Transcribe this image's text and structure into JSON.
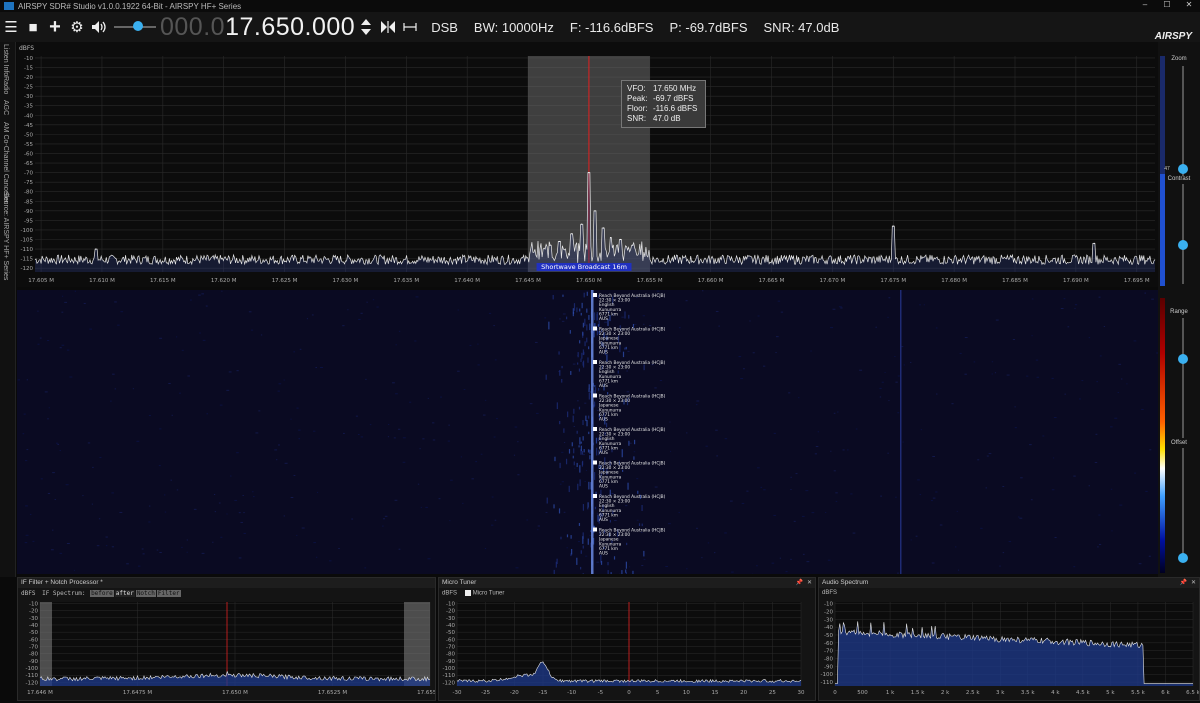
{
  "window": {
    "title": "AIRSPY SDR# Studio v1.0.0.1922 64-Bit - AIRSPY HF+ Series",
    "controls": [
      "–",
      "☐",
      "✕"
    ]
  },
  "toolbar": {
    "freq_dim": "000.0",
    "freq_lit": "17.650.000",
    "mode": "DSB",
    "bw": "BW: 10000Hz",
    "floor": "F: -116.6dBFS",
    "peak": "P: -69.7dBFS",
    "snr": "SNR: 47.0dB",
    "brand": "AIRSPY",
    "volume_level": 0.55
  },
  "left_tabs": [
    "Listen Info",
    "Radio",
    "AGC",
    "AM Co-Channel Canceller",
    "Source: AIRSPY HF+ Series"
  ],
  "spectrum": {
    "unit": "dBFS",
    "y_ticks": [
      -10,
      -15,
      -20,
      -25,
      -30,
      -35,
      -40,
      -45,
      -50,
      -55,
      -60,
      -65,
      -70,
      -75,
      -80,
      -85,
      -90,
      -95,
      -100,
      -105,
      -110,
      -115,
      -120
    ],
    "x_ticks": [
      "17.605 M",
      "17.610 M",
      "17.615 M",
      "17.620 M",
      "17.625 M",
      "17.630 M",
      "17.635 M",
      "17.640 M",
      "17.645 M",
      "17.650 M",
      "17.655 M",
      "17.660 M",
      "17.665 M",
      "17.670 M",
      "17.675 M",
      "17.680 M",
      "17.685 M",
      "17.690 M",
      "17.695 M"
    ],
    "x_range": [
      17.6045,
      17.6965
    ],
    "filter_range": [
      17.645,
      17.655
    ],
    "band_label": "Shortwave Broadcast 16m",
    "noise_floor": -117,
    "peaks": [
      {
        "x": 17.65,
        "y": -70
      },
      {
        "x": 17.6505,
        "y": -90
      },
      {
        "x": 17.6494,
        "y": -97
      },
      {
        "x": 17.6512,
        "y": -99
      },
      {
        "x": 17.6486,
        "y": -102
      },
      {
        "x": 17.6518,
        "y": -104
      },
      {
        "x": 17.6476,
        "y": -106
      },
      {
        "x": 17.6526,
        "y": -105
      },
      {
        "x": 17.6468,
        "y": -108
      },
      {
        "x": 17.6536,
        "y": -108
      },
      {
        "x": 17.675,
        "y": -98
      },
      {
        "x": 17.6915,
        "y": -107
      },
      {
        "x": 17.6095,
        "y": -110
      }
    ]
  },
  "tooltip": {
    "vfo_k": "VFO:",
    "vfo_v": "17.650 MHz",
    "peak_k": "Peak:",
    "peak_v": "-69.7 dBFS",
    "floor_k": "Floor:",
    "floor_v": "-116.6 dBFS",
    "snr_k": "SNR:",
    "snr_v": "47.0 dB"
  },
  "waterfall": {
    "station": {
      "name": "Reach Beyond Australia (HCJB)",
      "time": "22:30 × 23:00",
      "langs": [
        "English",
        "Japanese"
      ],
      "site": "Kununurra",
      "dist": "6771 km",
      "country": "AUS"
    },
    "repeat": 8
  },
  "right_panel": {
    "zoom": "Zoom",
    "contrast": "Contrast",
    "range": "Range",
    "offset": "Offset",
    "contrast_value": "47"
  },
  "panels": {
    "if": {
      "title": "IF Filter + Notch Processor *",
      "label": "IF Spectrum:",
      "btns": [
        "before",
        "after",
        "Notch",
        "Filter"
      ],
      "unit": "dBFS",
      "y_ticks": [
        -10,
        -20,
        -30,
        -40,
        -50,
        -60,
        -70,
        -80,
        -90,
        -100,
        -110,
        -120
      ],
      "x_ticks": [
        "17.646 M",
        "17.6475 M",
        "17.650 M",
        "17.6525 M",
        "17.655 M"
      ]
    },
    "tuner": {
      "title": "Micro Tuner",
      "checkbox": "Micro Tuner",
      "unit": "dBFS",
      "y_ticks": [
        -10,
        -20,
        -30,
        -40,
        -50,
        -60,
        -70,
        -80,
        -90,
        -100,
        -110,
        -120
      ],
      "x_ticks": [
        "-30",
        "-25",
        "-20",
        "-15",
        "-10",
        "-5",
        "0",
        "5",
        "10",
        "15",
        "20",
        "25",
        "30"
      ]
    },
    "audio": {
      "title": "Audio Spectrum",
      "unit": "dBFS",
      "y_ticks": [
        -10,
        -20,
        -30,
        -40,
        -50,
        -60,
        -70,
        -80,
        -90,
        -100,
        -110
      ],
      "x_ticks": [
        "0",
        "500",
        "1 k",
        "1.5 k",
        "2 k",
        "2.5 k",
        "3 k",
        "3.5 k",
        "4 k",
        "4.5 k",
        "5 k",
        "5.5 k",
        "6 k",
        "6.5 k"
      ]
    }
  },
  "colors": {
    "accent": "#3ab0f0",
    "trace": "#e8e8e8",
    "vfo": "#e02020",
    "band": "#2030c0",
    "waterfall_bg": "#0a0a22"
  }
}
